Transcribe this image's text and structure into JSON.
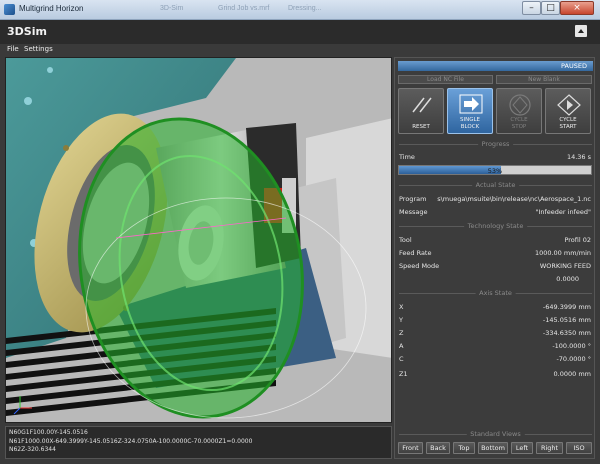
{
  "window": {
    "title": "Multigrind Horizon",
    "ghost_tabs": [
      "3D-Sim",
      "Grind Job vs.mrf",
      "Dressing..."
    ]
  },
  "window_controls": {
    "minimize": "–",
    "maximize": "□",
    "close": "×"
  },
  "app": {
    "name": "3DSim"
  },
  "menu": {
    "file": "File",
    "settings": "Settings"
  },
  "nc_code": {
    "lines": [
      "N60G1F100.00Y-145.0516",
      "N61F1000.00X-649.3999Y-145.0516Z-324.0750A-100.0000C-70.0000Z1=0.0000",
      "N62Z-320.6344"
    ]
  },
  "status": {
    "state": "PAUSED"
  },
  "file_buttons": {
    "load": "Load NC File",
    "new_blank": "New Blank"
  },
  "controls": {
    "reset": "RESET",
    "single_block_1": "SINGLE",
    "single_block_2": "BLOCK",
    "cycle_stop_1": "CYCLE",
    "cycle_stop_2": "STOP",
    "cycle_start_1": "CYCLE",
    "cycle_start_2": "START"
  },
  "progress": {
    "section": "Progress",
    "time_label": "Time",
    "time_value": "14.36 s",
    "percent": 53,
    "percent_label": "53%"
  },
  "actual_state": {
    "section": "Actual State",
    "program_label": "Program",
    "program_value": "s\\muega\\msuite\\bin\\release\\nc\\Aerospace_1.nc",
    "message_label": "Message",
    "message_value": "\"Infeeder infeed\""
  },
  "technology": {
    "section": "Technology State",
    "tool_label": "Tool",
    "tool_value": "Profil 02",
    "feed_label": "Feed Rate",
    "feed_value": "1000.00 mm/min",
    "speed_label": "Speed Mode",
    "speed_value": "WORKING FEED",
    "speed_extra": "0.0000"
  },
  "axis_state": {
    "section": "Axis State",
    "axes": [
      {
        "name": "X",
        "value": "-649.3999 mm"
      },
      {
        "name": "Y",
        "value": "-145.0516 mm"
      },
      {
        "name": "Z",
        "value": "-334.6350 mm"
      },
      {
        "name": "A",
        "value": "-100.0000 °"
      },
      {
        "name": "C",
        "value": "-70.0000 °"
      },
      {
        "name": "Z1",
        "value": "0.0000 mm"
      }
    ]
  },
  "standard_views": {
    "section": "Standard Views",
    "buttons": [
      "Front",
      "Back",
      "Top",
      "Bottom",
      "Left",
      "Right",
      "ISO"
    ]
  },
  "colors": {
    "accent": "#3d74b0",
    "grind_wheel": "#29b52e",
    "flange": "#c8b96a",
    "machine_teal": "#3f8c8c",
    "panel_bg": "#3c3c3c"
  }
}
